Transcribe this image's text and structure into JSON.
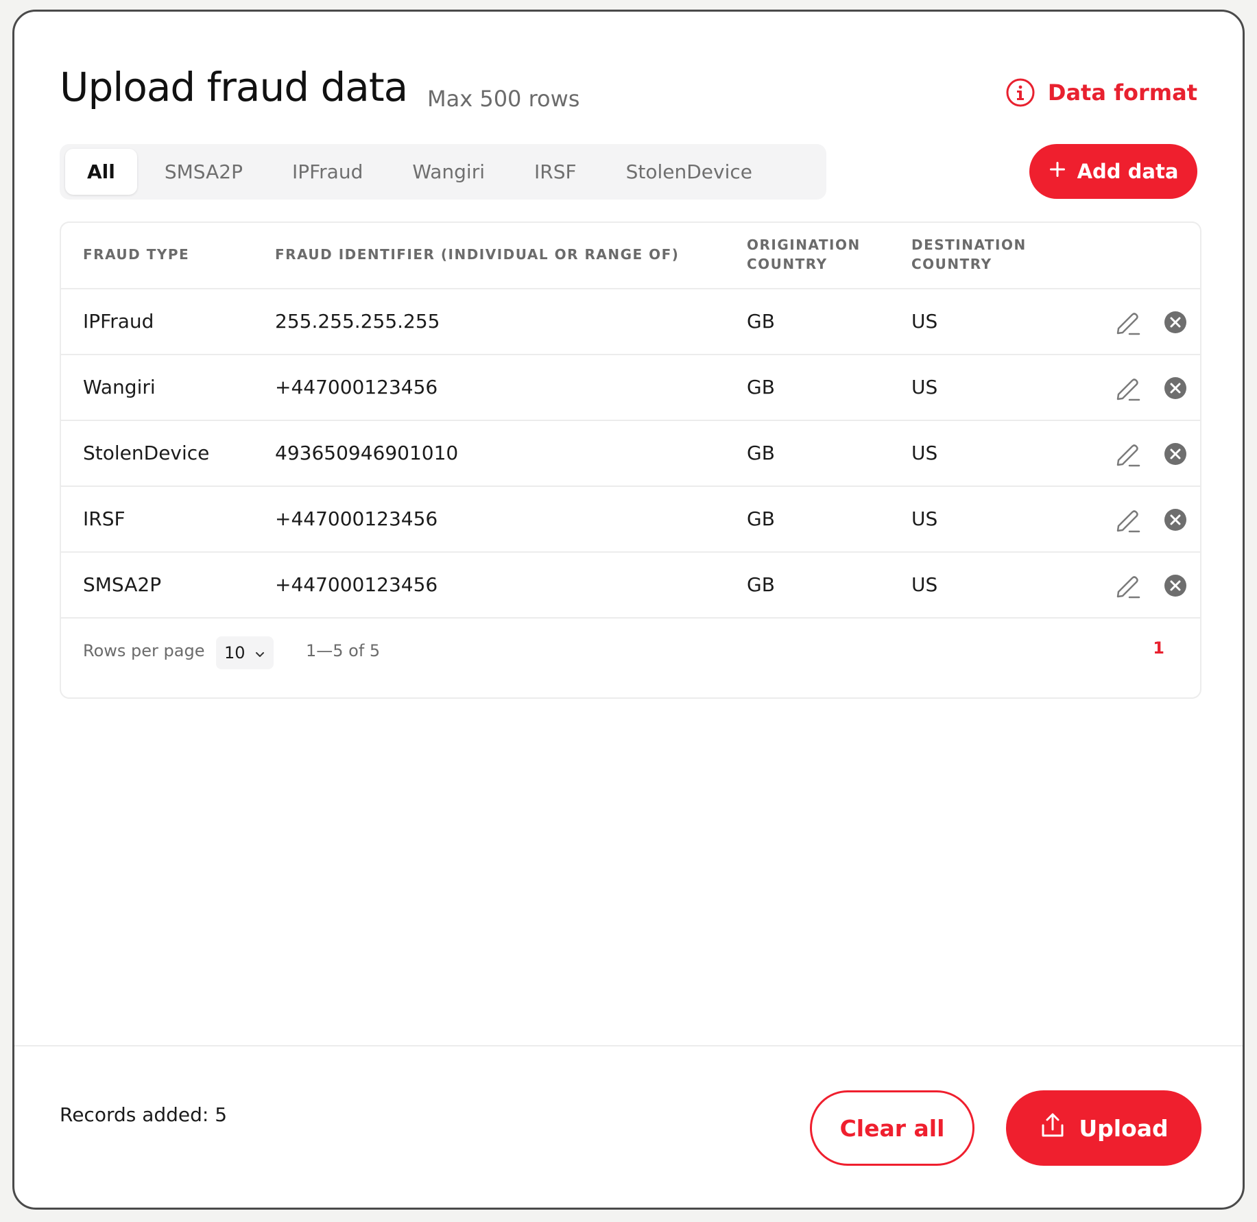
{
  "header": {
    "title": "Upload fraud data",
    "subtitle": "Max 500 rows",
    "data_format_label": "Data format"
  },
  "tabs": [
    {
      "label": "All",
      "active": true
    },
    {
      "label": "SMSA2P",
      "active": false
    },
    {
      "label": "IPFraud",
      "active": false
    },
    {
      "label": "Wangiri",
      "active": false
    },
    {
      "label": "IRSF",
      "active": false
    },
    {
      "label": "StolenDevice",
      "active": false
    }
  ],
  "add_data_label": "Add data",
  "table": {
    "columns": [
      "FRAUD TYPE",
      "FRAUD IDENTIFIER (INDIVIDUAL OR RANGE OF)",
      "ORIGINATION COUNTRY",
      "DESTINATION COUNTRY"
    ],
    "rows": [
      {
        "fraud_type": "IPFraud",
        "identifier": "255.255.255.255",
        "origination": "GB",
        "destination": "US"
      },
      {
        "fraud_type": "Wangiri",
        "identifier": "+447000123456",
        "origination": "GB",
        "destination": "US"
      },
      {
        "fraud_type": "StolenDevice",
        "identifier": "493650946901010",
        "origination": "GB",
        "destination": "US"
      },
      {
        "fraud_type": "IRSF",
        "identifier": "+447000123456",
        "origination": "GB",
        "destination": "US"
      },
      {
        "fraud_type": "SMSA2P",
        "identifier": "+447000123456",
        "origination": "GB",
        "destination": "US"
      }
    ]
  },
  "pagination": {
    "rows_per_page_label": "Rows per page",
    "rows_per_page_value": "10",
    "range_text": "1—5 of 5",
    "current_page": "1"
  },
  "footer": {
    "records_added": "Records added: 5",
    "clear_all_label": "Clear all",
    "upload_label": "Upload"
  },
  "colors": {
    "accent": "#ef1f2e",
    "muted_text": "#6b6b6b",
    "border": "#ececec"
  },
  "icons": {
    "info": "info-circle-icon",
    "add": "plus-icon",
    "edit": "pencil-icon",
    "delete": "close-circle-icon",
    "dropdown": "chevron-down-icon",
    "upload": "upload-icon"
  }
}
